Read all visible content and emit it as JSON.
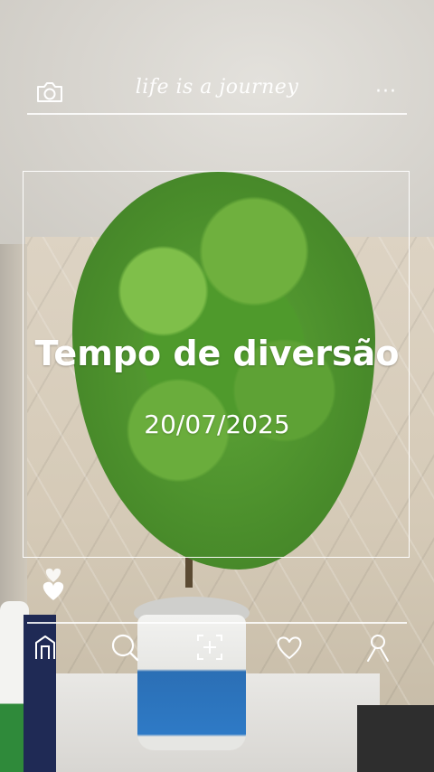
{
  "header": {
    "tagline": "life is a journey",
    "camera_icon": "camera-icon",
    "more_icon": "more-dots-icon",
    "more_glyph": "···"
  },
  "card": {
    "title": "Tempo de diversão",
    "date": "20/07/2025",
    "like_icon": "hearts-icon"
  },
  "bottom_nav": {
    "items": [
      {
        "icon": "home-icon"
      },
      {
        "icon": "search-icon"
      },
      {
        "icon": "add-photo-icon"
      },
      {
        "icon": "heart-icon"
      },
      {
        "icon": "profile-icon"
      }
    ]
  },
  "colors": {
    "overlay": "#ffffff",
    "leaf_green": "#5ea537"
  }
}
